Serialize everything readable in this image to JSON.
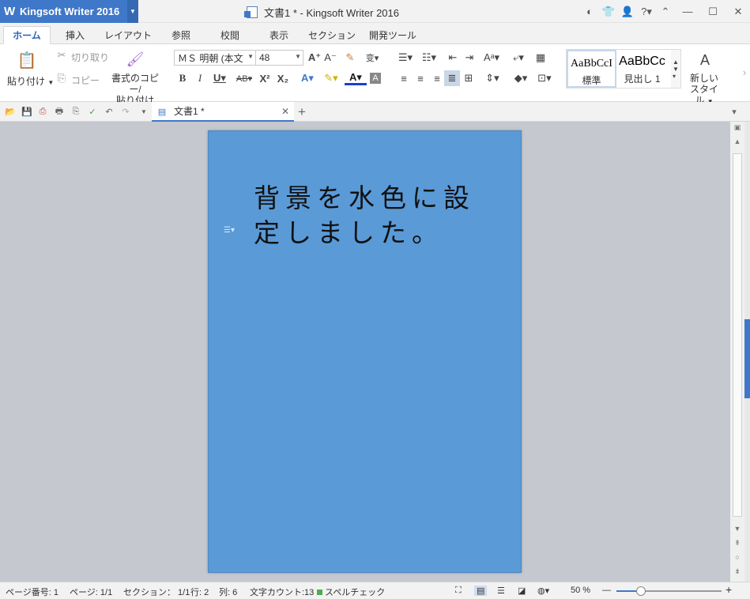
{
  "titlebar": {
    "app_name": "Kingsoft Writer 2016",
    "app_logo": "W",
    "window_title": "文書1 * - Kingsoft Writer 2016",
    "help_label": "?"
  },
  "ribbon_tabs": [
    {
      "label": "ホーム",
      "active": true
    },
    {
      "label": "挿入"
    },
    {
      "label": "レイアウト"
    },
    {
      "label": "参照"
    },
    {
      "label": "校閲"
    },
    {
      "label": "表示"
    },
    {
      "label": "セクション"
    },
    {
      "label": "開発ツール"
    }
  ],
  "clipboard": {
    "paste_label": "貼り付け",
    "cut_label": "切り取り",
    "copy_label": "コピー",
    "format_painter_label_1": "書式のコピー/",
    "format_painter_label_2": "貼り付け"
  },
  "font": {
    "font_name": "ＭＳ 明朝 (本文",
    "font_size": "48"
  },
  "styles": {
    "normal_preview": "AaBbCcI",
    "normal_label": "標準",
    "heading1_preview": "AaBbCc",
    "heading1_label": "見出し 1",
    "new_style_label_1": "新しい",
    "new_style_label_2": "スタイル"
  },
  "doc_tab": {
    "title": "文書1 *"
  },
  "document": {
    "text": "背景を水色に設定しました。",
    "page_color": "#5a9ad7"
  },
  "status": {
    "page_number": "ページ番号: 1",
    "page": "ページ: 1/1",
    "section": "セクション： 1/1",
    "row": "行: 2",
    "col": "列: 6",
    "word_count": "文字カウント:13",
    "spell_check": "スペルチェック",
    "zoom": "50 %",
    "zoom_level_fraction": 0.23
  },
  "colors": {
    "accent": "#3f78c8",
    "page_background": "#5a9ad7"
  }
}
